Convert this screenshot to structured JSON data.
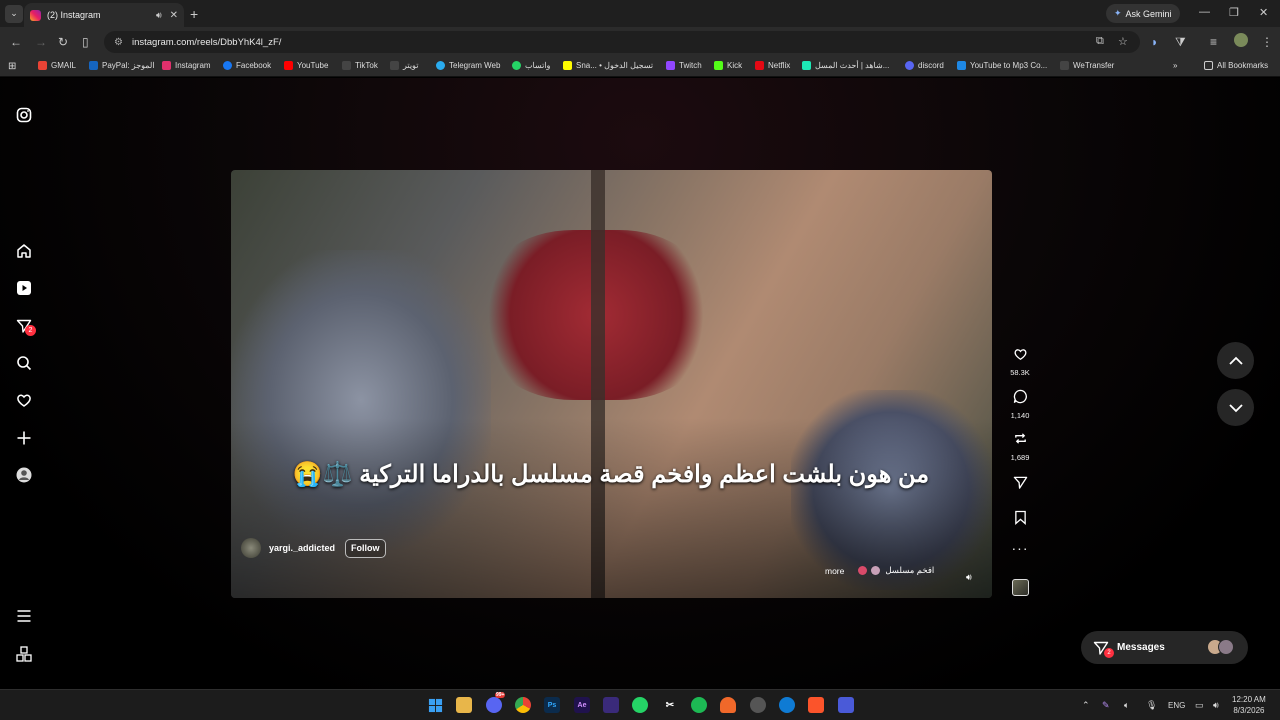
{
  "browser": {
    "tab_title": "(2) Instagram",
    "new_tab_symbol": "+",
    "ask_gemini": "Ask Gemini",
    "url": "instagram.com/reels/DbbYhK4l_zF/"
  },
  "bookmarks": [
    {
      "label": "GMAIL",
      "color": "#ea4335"
    },
    {
      "label": "PayPal: الموجز",
      "color": "#1565c0"
    },
    {
      "label": "Instagram",
      "color": "#e1306c"
    },
    {
      "label": "Facebook",
      "color": "#1877f2"
    },
    {
      "label": "YouTube",
      "color": "#ff0000"
    },
    {
      "label": "TikTok",
      "color": "#222222"
    },
    {
      "label": "تويتر",
      "color": "#333333"
    },
    {
      "label": "Telegram Web",
      "color": "#2aabee"
    },
    {
      "label": "واتساب",
      "color": "#25d366"
    },
    {
      "label": "Sna... • تسجيل الدخول",
      "color": "#fffc00"
    },
    {
      "label": "Twitch",
      "color": "#9146ff"
    },
    {
      "label": "Kick",
      "color": "#53fc18"
    },
    {
      "label": "Netflix",
      "color": "#e50914"
    },
    {
      "label": "شاهد | أحدث المسل...",
      "color": "#1de9b6"
    },
    {
      "label": "discord",
      "color": "#5865f2"
    },
    {
      "label": "YouTube to Mp3 Co...",
      "color": "#1e88e5"
    },
    {
      "label": "WeTransfer",
      "color": "#333333"
    }
  ],
  "all_bookmarks": "All Bookmarks",
  "sidebar": {
    "notification_count": "2"
  },
  "reel": {
    "caption": "من هون بلشت اعظم وافخم قصة مسلسل بالدراما التركية ⚖️😭",
    "username": "yargi._addicted",
    "follow_label": "Follow",
    "more_label": "more",
    "audio_label": "افخم مسلسل",
    "likes": "58.3K",
    "comments": "1,140",
    "reposts": "1,689"
  },
  "messages": {
    "label": "Messages",
    "badge": "2"
  },
  "taskbar": {
    "discord_badge": "99+",
    "language": "ENG",
    "time": "12:20 AM",
    "date": "8/3/2026"
  }
}
